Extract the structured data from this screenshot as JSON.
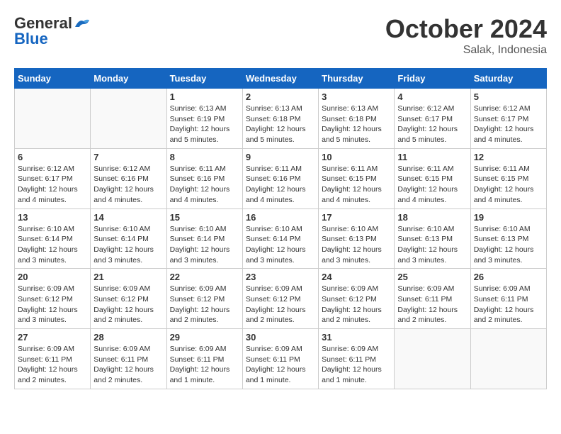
{
  "logo": {
    "general": "General",
    "blue": "Blue",
    "tagline": ""
  },
  "title": {
    "month_year": "October 2024",
    "location": "Salak, Indonesia"
  },
  "weekdays": [
    "Sunday",
    "Monday",
    "Tuesday",
    "Wednesday",
    "Thursday",
    "Friday",
    "Saturday"
  ],
  "weeks": [
    [
      {
        "day": "",
        "content": ""
      },
      {
        "day": "",
        "content": ""
      },
      {
        "day": "1",
        "content": "Sunrise: 6:13 AM\nSunset: 6:19 PM\nDaylight: 12 hours\nand 5 minutes."
      },
      {
        "day": "2",
        "content": "Sunrise: 6:13 AM\nSunset: 6:18 PM\nDaylight: 12 hours\nand 5 minutes."
      },
      {
        "day": "3",
        "content": "Sunrise: 6:13 AM\nSunset: 6:18 PM\nDaylight: 12 hours\nand 5 minutes."
      },
      {
        "day": "4",
        "content": "Sunrise: 6:12 AM\nSunset: 6:17 PM\nDaylight: 12 hours\nand 5 minutes."
      },
      {
        "day": "5",
        "content": "Sunrise: 6:12 AM\nSunset: 6:17 PM\nDaylight: 12 hours\nand 4 minutes."
      }
    ],
    [
      {
        "day": "6",
        "content": "Sunrise: 6:12 AM\nSunset: 6:17 PM\nDaylight: 12 hours\nand 4 minutes."
      },
      {
        "day": "7",
        "content": "Sunrise: 6:12 AM\nSunset: 6:16 PM\nDaylight: 12 hours\nand 4 minutes."
      },
      {
        "day": "8",
        "content": "Sunrise: 6:11 AM\nSunset: 6:16 PM\nDaylight: 12 hours\nand 4 minutes."
      },
      {
        "day": "9",
        "content": "Sunrise: 6:11 AM\nSunset: 6:16 PM\nDaylight: 12 hours\nand 4 minutes."
      },
      {
        "day": "10",
        "content": "Sunrise: 6:11 AM\nSunset: 6:15 PM\nDaylight: 12 hours\nand 4 minutes."
      },
      {
        "day": "11",
        "content": "Sunrise: 6:11 AM\nSunset: 6:15 PM\nDaylight: 12 hours\nand 4 minutes."
      },
      {
        "day": "12",
        "content": "Sunrise: 6:11 AM\nSunset: 6:15 PM\nDaylight: 12 hours\nand 4 minutes."
      }
    ],
    [
      {
        "day": "13",
        "content": "Sunrise: 6:10 AM\nSunset: 6:14 PM\nDaylight: 12 hours\nand 3 minutes."
      },
      {
        "day": "14",
        "content": "Sunrise: 6:10 AM\nSunset: 6:14 PM\nDaylight: 12 hours\nand 3 minutes."
      },
      {
        "day": "15",
        "content": "Sunrise: 6:10 AM\nSunset: 6:14 PM\nDaylight: 12 hours\nand 3 minutes."
      },
      {
        "day": "16",
        "content": "Sunrise: 6:10 AM\nSunset: 6:14 PM\nDaylight: 12 hours\nand 3 minutes."
      },
      {
        "day": "17",
        "content": "Sunrise: 6:10 AM\nSunset: 6:13 PM\nDaylight: 12 hours\nand 3 minutes."
      },
      {
        "day": "18",
        "content": "Sunrise: 6:10 AM\nSunset: 6:13 PM\nDaylight: 12 hours\nand 3 minutes."
      },
      {
        "day": "19",
        "content": "Sunrise: 6:10 AM\nSunset: 6:13 PM\nDaylight: 12 hours\nand 3 minutes."
      }
    ],
    [
      {
        "day": "20",
        "content": "Sunrise: 6:09 AM\nSunset: 6:12 PM\nDaylight: 12 hours\nand 3 minutes."
      },
      {
        "day": "21",
        "content": "Sunrise: 6:09 AM\nSunset: 6:12 PM\nDaylight: 12 hours\nand 2 minutes."
      },
      {
        "day": "22",
        "content": "Sunrise: 6:09 AM\nSunset: 6:12 PM\nDaylight: 12 hours\nand 2 minutes."
      },
      {
        "day": "23",
        "content": "Sunrise: 6:09 AM\nSunset: 6:12 PM\nDaylight: 12 hours\nand 2 minutes."
      },
      {
        "day": "24",
        "content": "Sunrise: 6:09 AM\nSunset: 6:12 PM\nDaylight: 12 hours\nand 2 minutes."
      },
      {
        "day": "25",
        "content": "Sunrise: 6:09 AM\nSunset: 6:11 PM\nDaylight: 12 hours\nand 2 minutes."
      },
      {
        "day": "26",
        "content": "Sunrise: 6:09 AM\nSunset: 6:11 PM\nDaylight: 12 hours\nand 2 minutes."
      }
    ],
    [
      {
        "day": "27",
        "content": "Sunrise: 6:09 AM\nSunset: 6:11 PM\nDaylight: 12 hours\nand 2 minutes."
      },
      {
        "day": "28",
        "content": "Sunrise: 6:09 AM\nSunset: 6:11 PM\nDaylight: 12 hours\nand 2 minutes."
      },
      {
        "day": "29",
        "content": "Sunrise: 6:09 AM\nSunset: 6:11 PM\nDaylight: 12 hours\nand 1 minute."
      },
      {
        "day": "30",
        "content": "Sunrise: 6:09 AM\nSunset: 6:11 PM\nDaylight: 12 hours\nand 1 minute."
      },
      {
        "day": "31",
        "content": "Sunrise: 6:09 AM\nSunset: 6:11 PM\nDaylight: 12 hours\nand 1 minute."
      },
      {
        "day": "",
        "content": ""
      },
      {
        "day": "",
        "content": ""
      }
    ]
  ]
}
